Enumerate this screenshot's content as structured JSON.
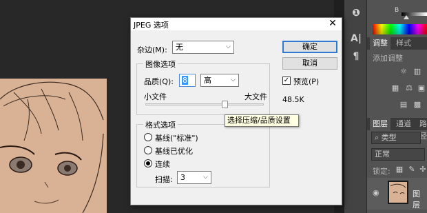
{
  "dialog": {
    "title": "JPEG 选项",
    "close_glyph": "✕",
    "matte_label": "杂边(M):",
    "matte_value": "无",
    "ok_label": "确定",
    "cancel_label": "取消",
    "preview_label": "预览(P)",
    "preview_checked": true,
    "file_size": "48.5K",
    "image_options": {
      "title": "图像选项",
      "quality_label": "品质(Q):",
      "quality_value": "8",
      "quality_preset": "高",
      "small_file_label": "小文件",
      "large_file_label": "大文件",
      "slider_fraction": 0.67
    },
    "format_options": {
      "title": "格式选项",
      "radio_baseline": "基线(\"标准\")",
      "radio_optimized": "基线已优化",
      "radio_progressive": "连续",
      "selected": "progressive",
      "scans_label": "扫描:",
      "scans_value": "3"
    },
    "tooltip": "选择压缩/品质设置"
  },
  "right_panel": {
    "channel_label": "B",
    "tab_adjustments": "调整",
    "tab_styles": "样式",
    "add_adjustment": "添加调整",
    "tab_layers": "图层",
    "tab_channels": "通道",
    "tab_paths": "路径",
    "filter_kind": "类型",
    "blend_mode": "正常",
    "lock_label": "锁定:",
    "layer_name": "图层"
  },
  "colors": {
    "ps_dark": "#282828",
    "ps_panel": "#535353",
    "dialog_bg": "#f0f0f0",
    "accent": "#2f7ad3",
    "tooltip_bg": "#ffffe1",
    "artwork_skin": "#d9b194"
  },
  "icons": [
    "info-icon",
    "type-icon",
    "paragraph-icon",
    "close-icon",
    "chevron-down-icon",
    "eye-icon",
    "brightness-icon",
    "levels-icon",
    "curves-icon",
    "exposure-icon",
    "vibrance-icon",
    "balance-icon",
    "lock-icon",
    "brush-icon"
  ]
}
